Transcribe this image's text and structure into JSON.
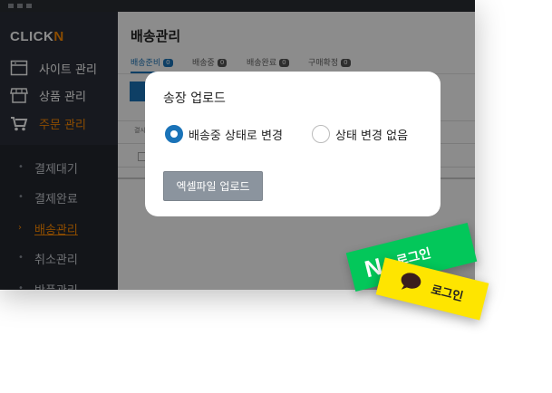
{
  "brand": {
    "logo_main": "CLICK",
    "logo_accent": "N",
    "accent_color": "#ff8a00"
  },
  "sidebar": {
    "menu": [
      {
        "label": "사이트 관리",
        "icon": "window-icon"
      },
      {
        "label": "상품 관리",
        "icon": "store-icon"
      },
      {
        "label": "주문 관리",
        "icon": "cart-icon",
        "active": true
      }
    ],
    "submenu": [
      {
        "label": "결제대기"
      },
      {
        "label": "결제완료"
      },
      {
        "label": "배송관리",
        "current": true
      },
      {
        "label": "취소관리"
      },
      {
        "label": "반품관리"
      }
    ]
  },
  "main": {
    "title": "배송관리",
    "tabs": [
      {
        "label": "배송준비",
        "count": "0",
        "active": true
      },
      {
        "label": "배송중",
        "count": "0"
      },
      {
        "label": "배송완료",
        "count": "0"
      },
      {
        "label": "구매확정",
        "count": "0"
      }
    ],
    "table_header_fragment": "결시"
  },
  "modal": {
    "title": "송장 업로드",
    "options": [
      {
        "label": "배송중 상태로 변경",
        "checked": true
      },
      {
        "label": "상태 변경 없음",
        "checked": false
      }
    ],
    "upload_button": "엑셀파일 업로드"
  },
  "social": {
    "naver": {
      "logo": "N",
      "label": "로그인",
      "color": "#03c75a"
    },
    "kakao": {
      "label": "로그인",
      "color": "#fee500"
    }
  }
}
